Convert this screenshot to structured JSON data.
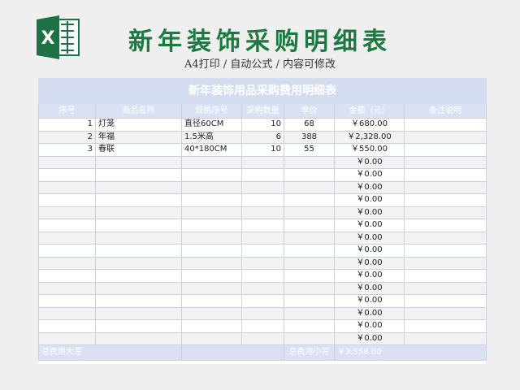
{
  "page": {
    "title": "新年装饰采购明细表",
    "subtitle": "A4打印 / 自动公式 / 内容可修改",
    "logo_icon": "excel-logo-icon",
    "accent_color": "#1b7a3f"
  },
  "sheet": {
    "banner": "新年装饰用品采购费用明细表",
    "headers": [
      "序号",
      "商品名称",
      "规格序号",
      "采购数量",
      "单价",
      "金额（元）",
      "备注说明"
    ],
    "rows": [
      [
        "1",
        "灯笼",
        "直径60CM",
        "10",
        "68",
        "￥680.00",
        ""
      ],
      [
        "2",
        "年福",
        "1.5米高",
        "6",
        "388",
        "￥2,328.00",
        ""
      ],
      [
        "3",
        "春联",
        "40*180CM",
        "10",
        "55",
        "￥550.00",
        ""
      ],
      [
        "",
        "",
        "",
        "",
        "",
        "￥0.00",
        ""
      ],
      [
        "",
        "",
        "",
        "",
        "",
        "￥0.00",
        ""
      ],
      [
        "",
        "",
        "",
        "",
        "",
        "￥0.00",
        ""
      ],
      [
        "",
        "",
        "",
        "",
        "",
        "￥0.00",
        ""
      ],
      [
        "",
        "",
        "",
        "",
        "",
        "￥0.00",
        ""
      ],
      [
        "",
        "",
        "",
        "",
        "",
        "￥0.00",
        ""
      ],
      [
        "",
        "",
        "",
        "",
        "",
        "￥0.00",
        ""
      ],
      [
        "",
        "",
        "",
        "",
        "",
        "￥0.00",
        ""
      ],
      [
        "",
        "",
        "",
        "",
        "",
        "￥0.00",
        ""
      ],
      [
        "",
        "",
        "",
        "",
        "",
        "￥0.00",
        ""
      ],
      [
        "",
        "",
        "",
        "",
        "",
        "￥0.00",
        ""
      ],
      [
        "",
        "",
        "",
        "",
        "",
        "￥0.00",
        ""
      ],
      [
        "",
        "",
        "",
        "",
        "",
        "￥0.00",
        ""
      ],
      [
        "",
        "",
        "",
        "",
        "",
        "￥0.00",
        ""
      ],
      [
        "",
        "",
        "",
        "",
        "",
        "￥0.00",
        ""
      ]
    ],
    "footer": {
      "total_caps_label": "总费用大写",
      "total_small_label": "总费用小写",
      "total_small_value": "￥3,558.00"
    }
  }
}
